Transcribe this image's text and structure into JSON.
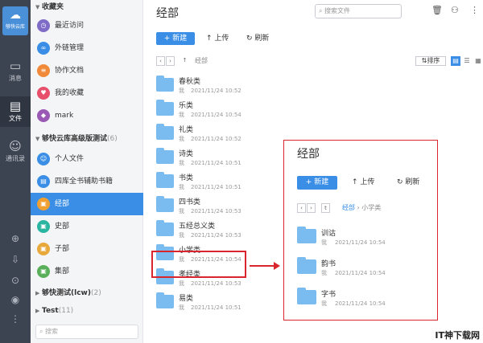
{
  "rail": {
    "logo_text": "够快云库",
    "items": [
      {
        "label": "消息",
        "icon": "message-icon"
      },
      {
        "label": "文件",
        "icon": "file-icon"
      },
      {
        "label": "通讯录",
        "icon": "contacts-icon"
      }
    ]
  },
  "sidebar": {
    "favorites_header": "收藏夹",
    "favorites": [
      {
        "label": "最近访问",
        "color": "#7e6cc7"
      },
      {
        "label": "外链管理",
        "color": "#3a8ee6"
      },
      {
        "label": "协作文档",
        "color": "#f08a3a"
      },
      {
        "label": "我的收藏",
        "color": "#e84f6b"
      },
      {
        "label": "mark",
        "color": "#9b59b6"
      }
    ],
    "library_header": "够快云库高级版测试",
    "library_count": "(6)",
    "library": [
      {
        "label": "个人文件",
        "color": "#3a8ee6"
      },
      {
        "label": "四库全书辅助书籍",
        "color": "#3a8ee6"
      },
      {
        "label": "经部",
        "color": "#f0a030"
      },
      {
        "label": "史部",
        "color": "#2ab5a0"
      },
      {
        "label": "子部",
        "color": "#e8a83a"
      },
      {
        "label": "集部",
        "color": "#5ab05a"
      }
    ],
    "group2_header": "够快测试(lcw)",
    "group2_count": "(2)",
    "group3_header": "Test",
    "group3_count": "(11)",
    "search_placeholder": "搜索"
  },
  "main": {
    "title": "经部",
    "search_placeholder": "搜索文件",
    "new_label": "+ 新建",
    "upload_label": "上传",
    "refresh_label": "刷新",
    "crumb": "经部",
    "sort_label": "排序",
    "files": [
      {
        "name": "春秋类",
        "owner": "我",
        "date": "2021/11/24 10:52"
      },
      {
        "name": "乐类",
        "owner": "我",
        "date": "2021/11/24 10:54"
      },
      {
        "name": "礼类",
        "owner": "我",
        "date": "2021/11/24 10:52"
      },
      {
        "name": "诗类",
        "owner": "我",
        "date": "2021/11/24 10:51"
      },
      {
        "name": "书类",
        "owner": "我",
        "date": "2021/11/24 10:51"
      },
      {
        "name": "四书类",
        "owner": "我",
        "date": "2021/11/24 10:53"
      },
      {
        "name": "五经总义类",
        "owner": "我",
        "date": "2021/11/24 10:53"
      },
      {
        "name": "小学类",
        "owner": "我",
        "date": "2021/11/24 10:54"
      },
      {
        "name": "孝经类",
        "owner": "我",
        "date": "2021/11/24 10:53"
      },
      {
        "name": "易类",
        "owner": "我",
        "date": "2021/11/24 10:51"
      }
    ]
  },
  "popup": {
    "title": "经部",
    "new_label": "+ 新建",
    "upload_label": "上传",
    "refresh_label": "刷新",
    "crumb_parent": "经部",
    "crumb_current": "小学类",
    "files": [
      {
        "name": "训诂",
        "owner": "我",
        "date": "2021/11/24 10:54"
      },
      {
        "name": "韵书",
        "owner": "我",
        "date": "2021/11/24 10:54"
      },
      {
        "name": "字书",
        "owner": "我",
        "date": "2021/11/24 10:54"
      }
    ]
  },
  "watermark": "IT神下载网"
}
